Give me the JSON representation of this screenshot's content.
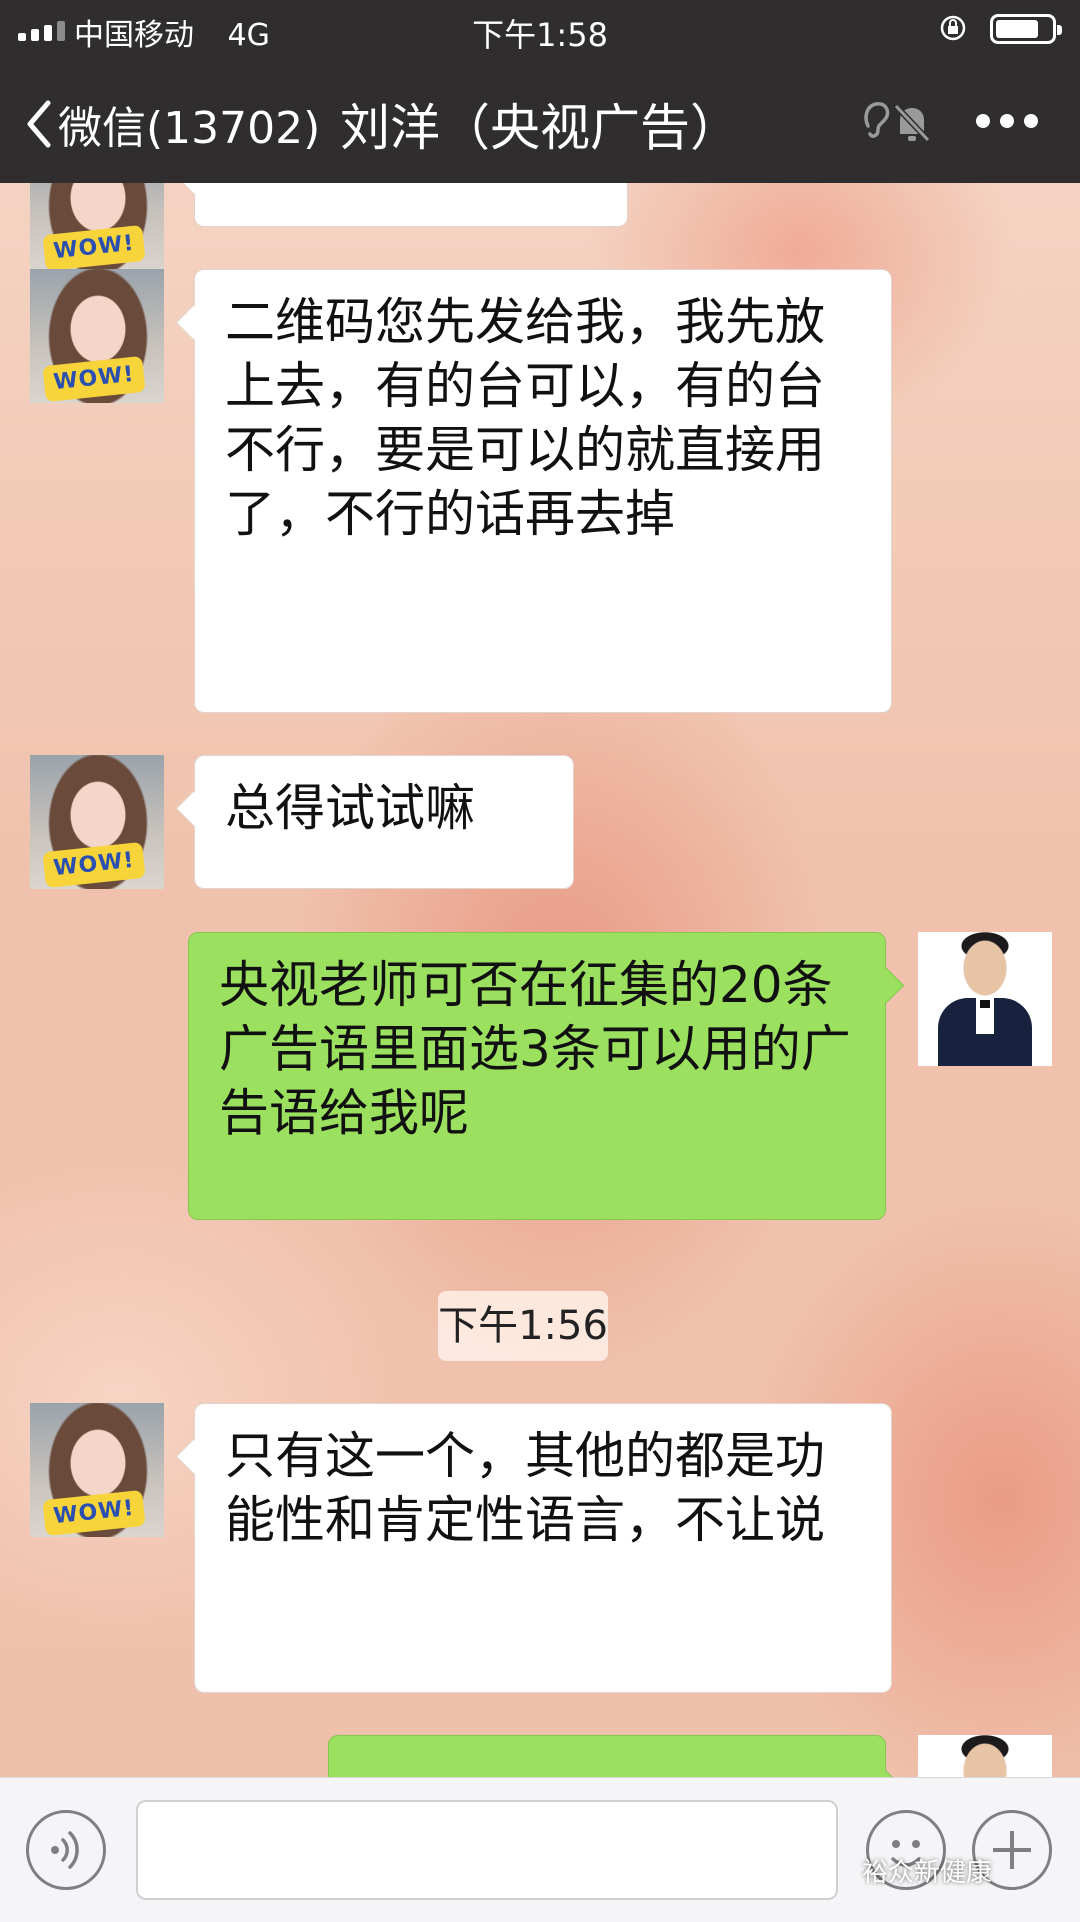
{
  "status_bar": {
    "carrier": "中国移动",
    "network": "4G",
    "time": "下午1:58"
  },
  "nav": {
    "back_label": "微信(13702)",
    "title": "刘洋（央视广告）"
  },
  "messages": [
    {
      "from": "contact",
      "text": ""
    },
    {
      "from": "contact",
      "text": "二维码您先发给我，我先放上去，有的台可以，有的台不行，要是可以的就直接用了，不行的话再去掉"
    },
    {
      "from": "contact",
      "text": "总得试试嘛"
    },
    {
      "from": "self",
      "text": "央视老师可否在征集的20条广告语里面选3条可以用的广告语给我呢"
    },
    {
      "from": "contact",
      "text": "只有这一个，其他的都是功能性和肯定性语言，不让说"
    },
    {
      "from": "self",
      "text": ""
    }
  ],
  "timestamp": "下午1:56",
  "avatar_badge": "WOW!",
  "watermark": "裕众新健康",
  "colors": {
    "header_bg": "#2f2d2e",
    "outgoing_bubble": "#9be15f",
    "incoming_bubble": "#ffffff"
  },
  "icons": [
    "chevron-left-icon",
    "ear-icon",
    "mute-bell-icon",
    "more-icon",
    "voice-icon",
    "emoji-icon",
    "plus-icon"
  ]
}
